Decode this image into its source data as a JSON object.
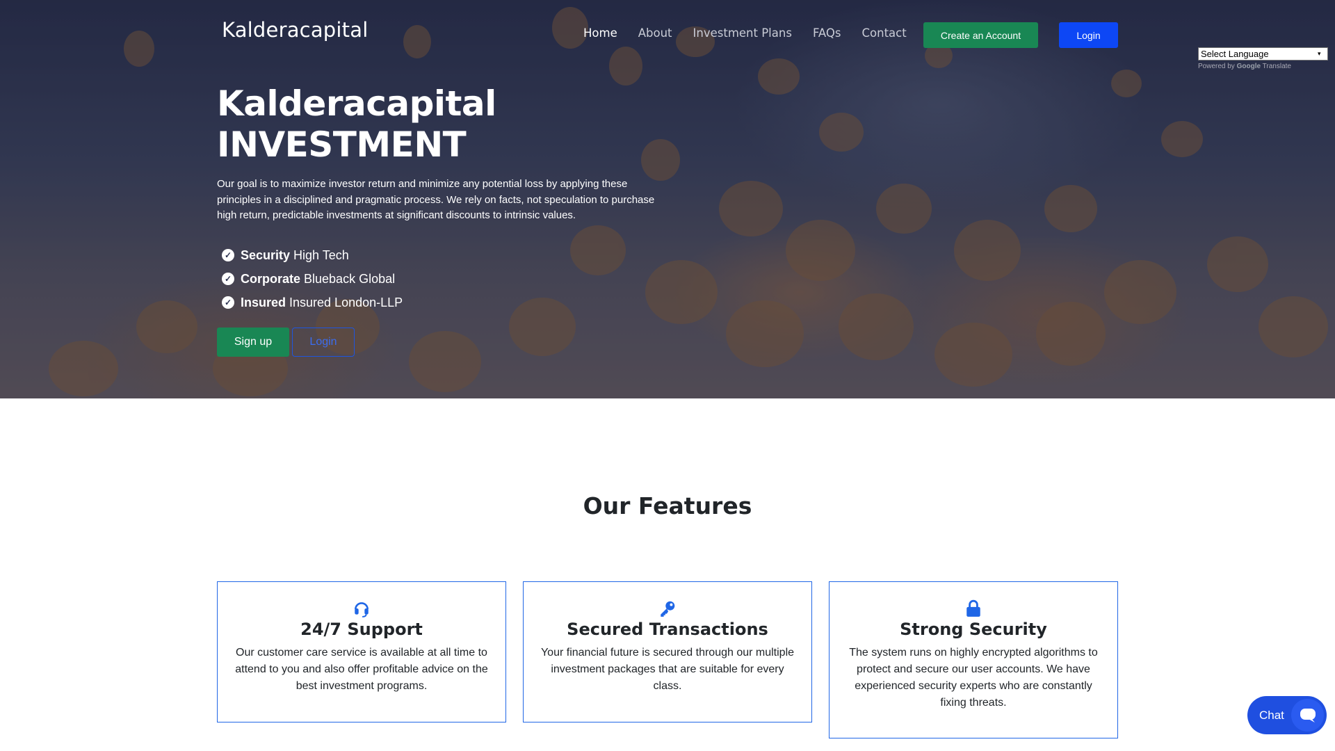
{
  "brand": "Kalderacapital",
  "nav": {
    "items": [
      "Home",
      "About",
      "Investment Plans",
      "FAQs",
      "Contact"
    ],
    "active": "Home",
    "create_account": "Create an Account",
    "login": "Login"
  },
  "translate": {
    "select_label": "Select Language",
    "powered_by": "Powered by",
    "google": "Google",
    "translate": "Translate"
  },
  "hero": {
    "title_line1": "Kalderacapital",
    "title_line2": "INVESTMENT",
    "description": "Our goal is to maximize investor return and minimize any potential loss by applying these principles in a disciplined and pragmatic process. We rely on facts, not speculation to purchase high return, predictable investments at significant discounts to intrinsic values.",
    "checks": [
      {
        "bold": "Security",
        "text": "High Tech"
      },
      {
        "bold": "Corporate",
        "text": "Blueback Global"
      },
      {
        "bold": "Insured",
        "text": "Insured London-LLP"
      }
    ],
    "signup": "Sign up",
    "login": "Login"
  },
  "features": {
    "title": "Our Features",
    "cards": [
      {
        "icon": "headset-icon",
        "title": "24/7 Support",
        "text": "Our customer care service is available at all time to attend to you and also offer profitable advice on the best investment programs."
      },
      {
        "icon": "key-icon",
        "title": "Secured Transactions",
        "text": "Your financial future is secured through our multiple investment packages that are suitable for every class."
      },
      {
        "icon": "lock-icon",
        "title": "Strong Security",
        "text": "The system runs on highly encrypted algorithms to protect and secure our user accounts. We have experienced security experts who are constantly fixing threats."
      }
    ]
  },
  "chat": {
    "label": "Chat",
    "icon": "chat-bubble-icon"
  },
  "colors": {
    "accent_green": "#198754",
    "accent_blue": "#0d47f5",
    "card_border": "#1f66e6",
    "icon_blue": "#1f66e6"
  }
}
